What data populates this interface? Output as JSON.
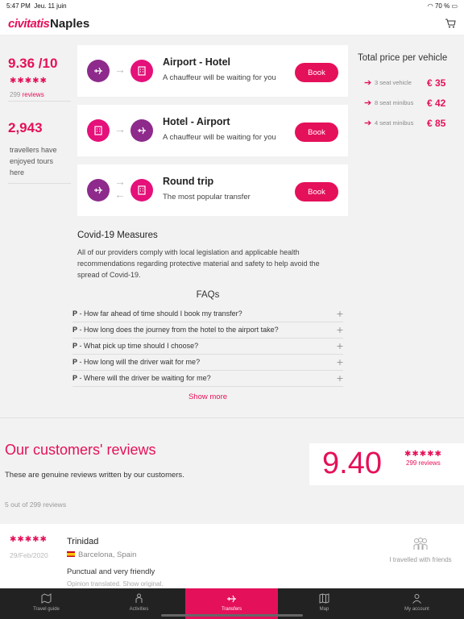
{
  "status": {
    "time": "5:47 PM",
    "date": "Jeu. 11 juin",
    "battery": "70 %"
  },
  "header": {
    "brand": "civitatis",
    "city": "Naples"
  },
  "rating": {
    "score": "9.36 /10",
    "stars": "✱✱✱✱✱",
    "reviews_count": "299",
    "reviews_label": "reviews"
  },
  "travellers": {
    "count": "2,943",
    "text": "travellers have enjoyed tours here"
  },
  "cards": [
    {
      "title": "Airport - Hotel",
      "subtitle": "A chauffeur will be waiting for you",
      "book": "Book",
      "from_icon": "plane-icon",
      "to_icon": "hotel-icon"
    },
    {
      "title": "Hotel - Airport",
      "subtitle": "A chauffeur will be waiting for you",
      "book": "Book",
      "from_icon": "hotel-icon",
      "to_icon": "plane-icon"
    },
    {
      "title": "Round trip",
      "subtitle": "The most popular transfer",
      "book": "Book",
      "from_icon": "plane-icon",
      "to_icon": "hotel-icon"
    }
  ],
  "price": {
    "title": "Total price per vehicle",
    "rows": [
      {
        "label": "3 seat vehicle",
        "price": "€ 35"
      },
      {
        "label": "8 seat minibus",
        "price": "€ 42"
      },
      {
        "label": "4 seat minibus",
        "price": "€ 85"
      }
    ]
  },
  "covid": {
    "title": "Covid-19 Measures",
    "text": "All of our providers comply with local legislation and applicable health recommendations regarding protective material and safety to help avoid the spread of Covid-19."
  },
  "faqs": {
    "title": "FAQs",
    "prefix": "P",
    "items": [
      "How far ahead of time should I book my transfer?",
      "How long does the journey from the hotel to the airport take?",
      "What pick up time should I choose?",
      "How long will the driver wait for me?",
      "Where will the driver be waiting for me?"
    ],
    "show_more": "Show more"
  },
  "reviews": {
    "title": "Our customers' reviews",
    "subtitle": "These are genuine reviews written by our customers.",
    "count_text": "5 out of 299 reviews",
    "score": "9.40",
    "score_stars": "✱✱✱✱✱",
    "score_reviews": "299 reviews"
  },
  "review": {
    "stars": "✱✱✱✱✱",
    "date": "29/Feb/2020",
    "name": "Trinidad",
    "location": "Barcelona, Spain",
    "text": "Punctual and very friendly",
    "note": "Opinion translated. Show original.",
    "travel_type": "I travelled with friends"
  },
  "nav": [
    {
      "label": "Travel guide",
      "icon": "map-pin-icon"
    },
    {
      "label": "Activities",
      "icon": "person-icon"
    },
    {
      "label": "Transfers",
      "icon": "plane-icon"
    },
    {
      "label": "Map",
      "icon": "map-icon"
    },
    {
      "label": "My account",
      "icon": "user-icon"
    }
  ],
  "colors": {
    "brand": "#e5105a",
    "plane_circle": "#8e2a8c",
    "hotel_circle": "#e5107a"
  }
}
